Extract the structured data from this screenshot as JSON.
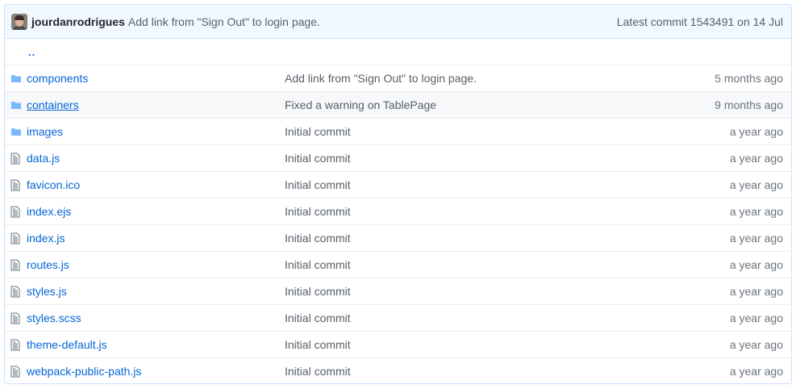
{
  "commit": {
    "author": "jourdanrodrigues",
    "message": "Add link from \"Sign Out\" to login page.",
    "latest": "Latest commit 1543491 on 14 Jul"
  },
  "parent_link": "..",
  "colors": {
    "folder": "#79b8ff",
    "file": "#6a737d",
    "link": "#0366d6",
    "header_bg": "#f1f8ff",
    "border": "#c8e1ff"
  },
  "files": [
    {
      "name": "components",
      "type": "folder",
      "icon": "folder-icon",
      "message": "Add link from \"Sign Out\" to login page.",
      "age": "5 months ago"
    },
    {
      "name": "containers",
      "type": "folder",
      "icon": "folder-icon",
      "message": "Fixed a warning on TablePage",
      "age": "9 months ago"
    },
    {
      "name": "images",
      "type": "folder",
      "icon": "folder-icon",
      "message": "Initial commit",
      "age": "a year ago"
    },
    {
      "name": "data.js",
      "type": "file",
      "icon": "file-icon",
      "message": "Initial commit",
      "age": "a year ago"
    },
    {
      "name": "favicon.ico",
      "type": "file",
      "icon": "file-icon",
      "message": "Initial commit",
      "age": "a year ago"
    },
    {
      "name": "index.ejs",
      "type": "file",
      "icon": "file-icon",
      "message": "Initial commit",
      "age": "a year ago"
    },
    {
      "name": "index.js",
      "type": "file",
      "icon": "file-icon",
      "message": "Initial commit",
      "age": "a year ago"
    },
    {
      "name": "routes.js",
      "type": "file",
      "icon": "file-icon",
      "message": "Initial commit",
      "age": "a year ago"
    },
    {
      "name": "styles.js",
      "type": "file",
      "icon": "file-icon",
      "message": "Initial commit",
      "age": "a year ago"
    },
    {
      "name": "styles.scss",
      "type": "file",
      "icon": "file-icon",
      "message": "Initial commit",
      "age": "a year ago"
    },
    {
      "name": "theme-default.js",
      "type": "file",
      "icon": "file-icon",
      "message": "Initial commit",
      "age": "a year ago"
    },
    {
      "name": "webpack-public-path.js",
      "type": "file",
      "icon": "file-icon",
      "message": "Initial commit",
      "age": "a year ago"
    }
  ]
}
